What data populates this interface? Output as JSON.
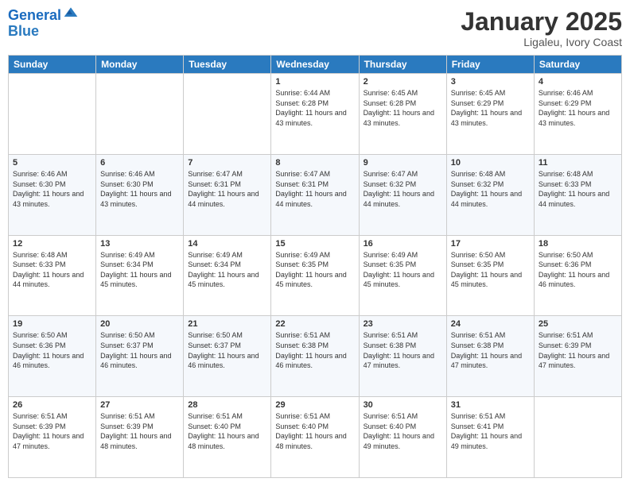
{
  "header": {
    "logo_line1": "General",
    "logo_line2": "Blue",
    "month": "January 2025",
    "location": "Ligaleu, Ivory Coast"
  },
  "weekdays": [
    "Sunday",
    "Monday",
    "Tuesday",
    "Wednesday",
    "Thursday",
    "Friday",
    "Saturday"
  ],
  "weeks": [
    [
      {
        "day": "",
        "info": ""
      },
      {
        "day": "",
        "info": ""
      },
      {
        "day": "",
        "info": ""
      },
      {
        "day": "1",
        "info": "Sunrise: 6:44 AM\nSunset: 6:28 PM\nDaylight: 11 hours and 43 minutes."
      },
      {
        "day": "2",
        "info": "Sunrise: 6:45 AM\nSunset: 6:28 PM\nDaylight: 11 hours and 43 minutes."
      },
      {
        "day": "3",
        "info": "Sunrise: 6:45 AM\nSunset: 6:29 PM\nDaylight: 11 hours and 43 minutes."
      },
      {
        "day": "4",
        "info": "Sunrise: 6:46 AM\nSunset: 6:29 PM\nDaylight: 11 hours and 43 minutes."
      }
    ],
    [
      {
        "day": "5",
        "info": "Sunrise: 6:46 AM\nSunset: 6:30 PM\nDaylight: 11 hours and 43 minutes."
      },
      {
        "day": "6",
        "info": "Sunrise: 6:46 AM\nSunset: 6:30 PM\nDaylight: 11 hours and 43 minutes."
      },
      {
        "day": "7",
        "info": "Sunrise: 6:47 AM\nSunset: 6:31 PM\nDaylight: 11 hours and 44 minutes."
      },
      {
        "day": "8",
        "info": "Sunrise: 6:47 AM\nSunset: 6:31 PM\nDaylight: 11 hours and 44 minutes."
      },
      {
        "day": "9",
        "info": "Sunrise: 6:47 AM\nSunset: 6:32 PM\nDaylight: 11 hours and 44 minutes."
      },
      {
        "day": "10",
        "info": "Sunrise: 6:48 AM\nSunset: 6:32 PM\nDaylight: 11 hours and 44 minutes."
      },
      {
        "day": "11",
        "info": "Sunrise: 6:48 AM\nSunset: 6:33 PM\nDaylight: 11 hours and 44 minutes."
      }
    ],
    [
      {
        "day": "12",
        "info": "Sunrise: 6:48 AM\nSunset: 6:33 PM\nDaylight: 11 hours and 44 minutes."
      },
      {
        "day": "13",
        "info": "Sunrise: 6:49 AM\nSunset: 6:34 PM\nDaylight: 11 hours and 45 minutes."
      },
      {
        "day": "14",
        "info": "Sunrise: 6:49 AM\nSunset: 6:34 PM\nDaylight: 11 hours and 45 minutes."
      },
      {
        "day": "15",
        "info": "Sunrise: 6:49 AM\nSunset: 6:35 PM\nDaylight: 11 hours and 45 minutes."
      },
      {
        "day": "16",
        "info": "Sunrise: 6:49 AM\nSunset: 6:35 PM\nDaylight: 11 hours and 45 minutes."
      },
      {
        "day": "17",
        "info": "Sunrise: 6:50 AM\nSunset: 6:35 PM\nDaylight: 11 hours and 45 minutes."
      },
      {
        "day": "18",
        "info": "Sunrise: 6:50 AM\nSunset: 6:36 PM\nDaylight: 11 hours and 46 minutes."
      }
    ],
    [
      {
        "day": "19",
        "info": "Sunrise: 6:50 AM\nSunset: 6:36 PM\nDaylight: 11 hours and 46 minutes."
      },
      {
        "day": "20",
        "info": "Sunrise: 6:50 AM\nSunset: 6:37 PM\nDaylight: 11 hours and 46 minutes."
      },
      {
        "day": "21",
        "info": "Sunrise: 6:50 AM\nSunset: 6:37 PM\nDaylight: 11 hours and 46 minutes."
      },
      {
        "day": "22",
        "info": "Sunrise: 6:51 AM\nSunset: 6:38 PM\nDaylight: 11 hours and 46 minutes."
      },
      {
        "day": "23",
        "info": "Sunrise: 6:51 AM\nSunset: 6:38 PM\nDaylight: 11 hours and 47 minutes."
      },
      {
        "day": "24",
        "info": "Sunrise: 6:51 AM\nSunset: 6:38 PM\nDaylight: 11 hours and 47 minutes."
      },
      {
        "day": "25",
        "info": "Sunrise: 6:51 AM\nSunset: 6:39 PM\nDaylight: 11 hours and 47 minutes."
      }
    ],
    [
      {
        "day": "26",
        "info": "Sunrise: 6:51 AM\nSunset: 6:39 PM\nDaylight: 11 hours and 47 minutes."
      },
      {
        "day": "27",
        "info": "Sunrise: 6:51 AM\nSunset: 6:39 PM\nDaylight: 11 hours and 48 minutes."
      },
      {
        "day": "28",
        "info": "Sunrise: 6:51 AM\nSunset: 6:40 PM\nDaylight: 11 hours and 48 minutes."
      },
      {
        "day": "29",
        "info": "Sunrise: 6:51 AM\nSunset: 6:40 PM\nDaylight: 11 hours and 48 minutes."
      },
      {
        "day": "30",
        "info": "Sunrise: 6:51 AM\nSunset: 6:40 PM\nDaylight: 11 hours and 49 minutes."
      },
      {
        "day": "31",
        "info": "Sunrise: 6:51 AM\nSunset: 6:41 PM\nDaylight: 11 hours and 49 minutes."
      },
      {
        "day": "",
        "info": ""
      }
    ]
  ]
}
